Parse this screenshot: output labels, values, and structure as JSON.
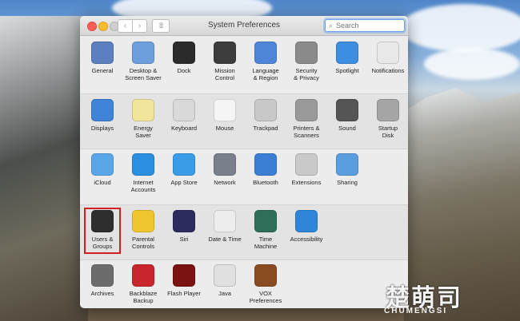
{
  "window": {
    "title": "System Preferences"
  },
  "search": {
    "placeholder": "Search"
  },
  "rows": [
    [
      {
        "label": "General",
        "icon": "general-icon",
        "color": "#5b7fbf"
      },
      {
        "label": "Desktop &\nScreen Saver",
        "icon": "desktop-screensaver-icon",
        "color": "#6d9fdc"
      },
      {
        "label": "Dock",
        "icon": "dock-icon",
        "color": "#2b2b2b"
      },
      {
        "label": "Mission\nControl",
        "icon": "mission-control-icon",
        "color": "#3c3c3c"
      },
      {
        "label": "Language\n& Region",
        "icon": "language-region-icon",
        "color": "#4d86d6"
      },
      {
        "label": "Security\n& Privacy",
        "icon": "security-privacy-icon",
        "color": "#8a8a8a"
      },
      {
        "label": "Spotlight",
        "icon": "spotlight-icon",
        "color": "#3c8fe0"
      },
      {
        "label": "Notifications",
        "icon": "notifications-icon",
        "color": "#e8e8e8"
      }
    ],
    [
      {
        "label": "Displays",
        "icon": "displays-icon",
        "color": "#3f84d6"
      },
      {
        "label": "Energy\nSaver",
        "icon": "energy-saver-icon",
        "color": "#f2e49a"
      },
      {
        "label": "Keyboard",
        "icon": "keyboard-icon",
        "color": "#d9d9d9"
      },
      {
        "label": "Mouse",
        "icon": "mouse-icon",
        "color": "#f5f5f5"
      },
      {
        "label": "Trackpad",
        "icon": "trackpad-icon",
        "color": "#c8c8c8"
      },
      {
        "label": "Printers &\nScanners",
        "icon": "printer-icon",
        "color": "#9a9a9a"
      },
      {
        "label": "Sound",
        "icon": "sound-icon",
        "color": "#555555"
      },
      {
        "label": "Startup\nDisk",
        "icon": "startup-disk-icon",
        "color": "#a5a5a5"
      }
    ],
    [
      {
        "label": "iCloud",
        "icon": "icloud-icon",
        "color": "#5aa6e8"
      },
      {
        "label": "Internet\nAccounts",
        "icon": "internet-accounts-icon",
        "color": "#2a8fe0"
      },
      {
        "label": "App Store",
        "icon": "app-store-icon",
        "color": "#3a9be6"
      },
      {
        "label": "Network",
        "icon": "network-icon",
        "color": "#7a7f8c"
      },
      {
        "label": "Bluetooth",
        "icon": "bluetooth-icon",
        "color": "#3b7fd4"
      },
      {
        "label": "Extensions",
        "icon": "extensions-icon",
        "color": "#c9c9c9"
      },
      {
        "label": "Sharing",
        "icon": "sharing-icon",
        "color": "#5a9ee0"
      }
    ],
    [
      {
        "label": "Users &\nGroups",
        "icon": "users-groups-icon",
        "color": "#2e2e2e"
      },
      {
        "label": "Parental\nControls",
        "icon": "parental-controls-icon",
        "color": "#f0c62e"
      },
      {
        "label": "Siri",
        "icon": "siri-icon",
        "color": "#2b2b5e"
      },
      {
        "label": "Date & Time",
        "icon": "date-time-icon",
        "color": "#ededed"
      },
      {
        "label": "Time\nMachine",
        "icon": "time-machine-icon",
        "color": "#2f6f5a"
      },
      {
        "label": "Accessibility",
        "icon": "accessibility-icon",
        "color": "#2f86d8"
      }
    ],
    [
      {
        "label": "Archives",
        "icon": "archives-icon",
        "color": "#6c6c6c"
      },
      {
        "label": "Backblaze\nBackup",
        "icon": "backblaze-icon",
        "color": "#c8262c"
      },
      {
        "label": "Flash Player",
        "icon": "flash-player-icon",
        "color": "#7a1212"
      },
      {
        "label": "Java",
        "icon": "java-icon",
        "color": "#e0e0e0"
      },
      {
        "label": "VOX Preferences",
        "icon": "vox-icon",
        "color": "#8a4a22"
      }
    ]
  ],
  "watermark": {
    "main": "楚萌司",
    "sub": "CHUMENGSI"
  }
}
